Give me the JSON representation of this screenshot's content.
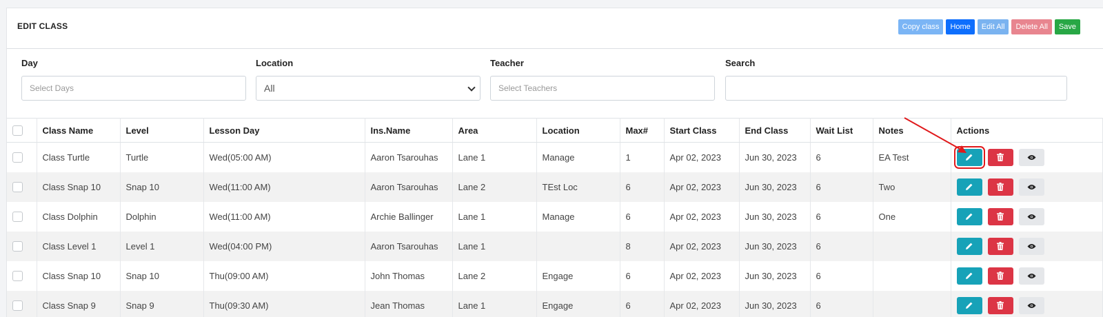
{
  "header": {
    "title": "EDIT CLASS",
    "buttons": {
      "copy": "Copy class",
      "home": "Home",
      "edit_all": "Edit All",
      "delete_all": "Delete All",
      "save": "Save"
    }
  },
  "filters": {
    "day": {
      "label": "Day",
      "placeholder": "Select Days"
    },
    "location": {
      "label": "Location",
      "value": "All"
    },
    "teacher": {
      "label": "Teacher",
      "placeholder": "Select Teachers"
    },
    "search": {
      "label": "Search",
      "value": ""
    }
  },
  "table": {
    "columns": [
      "Class Name",
      "Level",
      "Lesson Day",
      "Ins.Name",
      "Area",
      "Location",
      "Max#",
      "Start Class",
      "End Class",
      "Wait List",
      "Notes",
      "Actions"
    ],
    "rows": [
      [
        "Class Turtle",
        "Turtle",
        "Wed(05:00 AM)",
        "Aaron Tsarouhas",
        "Lane 1",
        "Manage",
        "1",
        "Apr 02, 2023",
        "Jun 30, 2023",
        "6",
        "EA Test"
      ],
      [
        "Class Snap 10",
        "Snap 10",
        "Wed(11:00 AM)",
        "Aaron Tsarouhas",
        "Lane 2",
        "TEst Loc",
        "6",
        "Apr 02, 2023",
        "Jun 30, 2023",
        "6",
        "Two"
      ],
      [
        "Class Dolphin",
        "Dolphin",
        "Wed(11:00 AM)",
        "Archie Ballinger",
        "Lane 1",
        "Manage",
        "6",
        "Apr 02, 2023",
        "Jun 30, 2023",
        "6",
        "One"
      ],
      [
        "Class Level 1",
        "Level 1",
        "Wed(04:00 PM)",
        "Aaron Tsarouhas",
        "Lane 1",
        "",
        "8",
        "Apr 02, 2023",
        "Jun 30, 2023",
        "6",
        ""
      ],
      [
        "Class Snap 10",
        "Snap 10",
        "Thu(09:00 AM)",
        "John Thomas",
        "Lane 2",
        "Engage",
        "6",
        "Apr 02, 2023",
        "Jun 30, 2023",
        "6",
        ""
      ],
      [
        "Class Snap 9",
        "Snap 9",
        "Thu(09:30 AM)",
        "Jean Thomas",
        "Lane 1",
        "Engage",
        "6",
        "Apr 02, 2023",
        "Jun 30, 2023",
        "6",
        ""
      ]
    ]
  },
  "icons": {
    "edit": "pencil-icon",
    "delete": "trash-icon",
    "view": "eye-icon"
  },
  "colors": {
    "edit_action": "#17a2b8",
    "delete_action": "#dc3545",
    "highlight": "#e0191b"
  }
}
